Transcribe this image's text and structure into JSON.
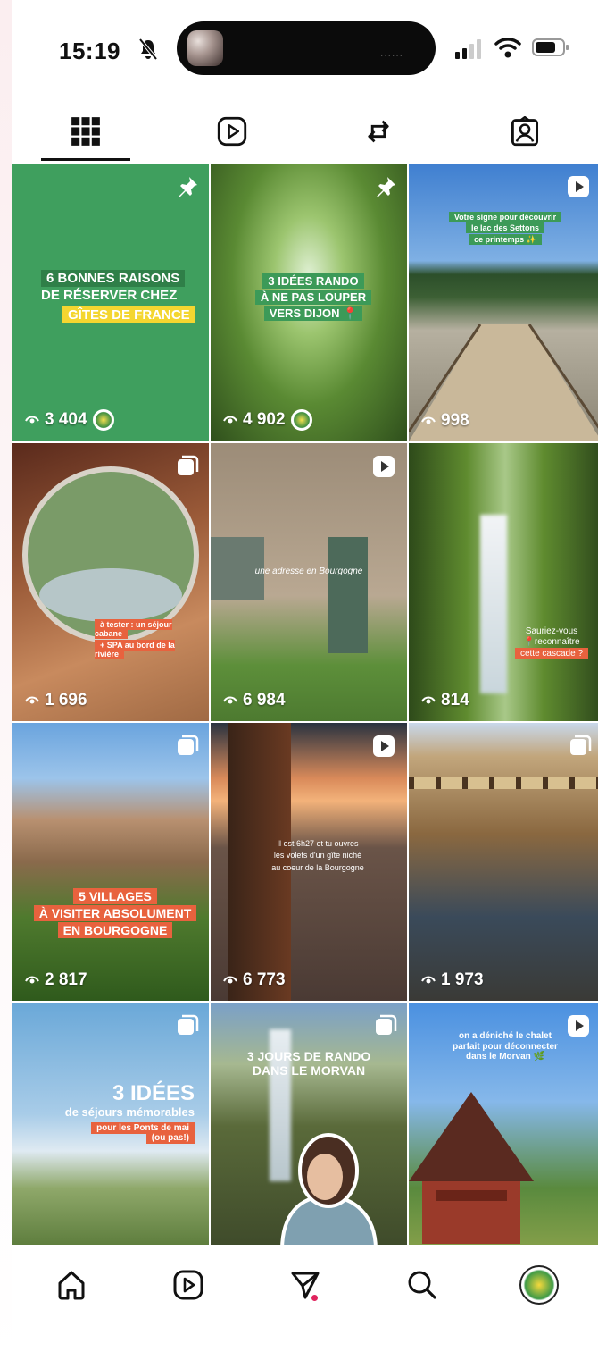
{
  "status_bar": {
    "time": "15:19",
    "dots": "......"
  },
  "icons": {
    "tab_grid": "grid-icon",
    "tab_reels": "reels-icon",
    "tab_reposts": "repost-icon",
    "tab_tagged": "tagged-icon",
    "nav_home": "home-icon",
    "nav_reels": "reels-icon",
    "nav_messages": "send-icon",
    "nav_search": "search-icon",
    "nav_profile": "avatar"
  },
  "posts": [
    {
      "views": "3 404",
      "lines": [
        "6 BONNES RAISONS",
        "DE RÉSERVER CHEZ",
        "GÎTES DE FRANCE"
      ]
    },
    {
      "views": "4 902",
      "lines": [
        "3 IDÉES RANDO",
        "À NE PAS LOUPER",
        "VERS DIJON 📍"
      ]
    },
    {
      "views": "998",
      "lines": [
        "Votre signe pour découvrir",
        "le lac des Settons",
        "ce printemps ✨"
      ]
    },
    {
      "views": "1 696",
      "lines": [
        "à tester : un séjour cabane",
        "+ SPA au bord de la rivière"
      ]
    },
    {
      "views": "6 984",
      "lines": [
        "une adresse en Bourgogne"
      ]
    },
    {
      "views": "814",
      "lines": [
        "Sauriez-vous",
        "📍reconnaître",
        "cette cascade ?"
      ]
    },
    {
      "views": "2 817",
      "lines": [
        "5 VILLAGES",
        "À VISITER ABSOLUMENT",
        "EN BOURGOGNE"
      ]
    },
    {
      "views": "6 773",
      "lines": [
        "Il est 6h27 et tu ouvres",
        "les volets d'un gîte niché",
        "au coeur de la Bourgogne"
      ]
    },
    {
      "views": "1 973",
      "lines": []
    },
    {
      "views": "",
      "lines": [
        "3 IDÉES",
        "de séjours mémorables",
        "pour les Ponts de mai",
        "(ou pas!)"
      ]
    },
    {
      "views": "",
      "lines": [
        "3 JOURS DE RANDO",
        "DANS LE MORVAN"
      ]
    },
    {
      "views": "",
      "lines": [
        "on a déniché le chalet",
        "parfait pour déconnecter",
        "dans le Morvan 🌿"
      ]
    }
  ]
}
